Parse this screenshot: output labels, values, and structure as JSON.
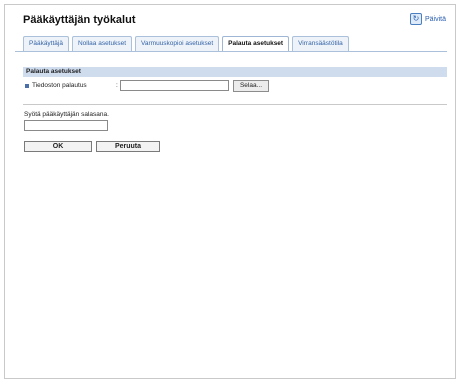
{
  "page": {
    "title": "Pääkäyttäjän työkalut"
  },
  "refresh": {
    "label": "Päivitä",
    "icon": "refresh-icon"
  },
  "tabs": [
    {
      "label": "Pääkäyttäjä",
      "active": false
    },
    {
      "label": "Nollaa asetukset",
      "active": false
    },
    {
      "label": "Varmuuskopioi asetukset",
      "active": false
    },
    {
      "label": "Palauta asetukset",
      "active": true
    },
    {
      "label": "Virransäästötila",
      "active": false
    }
  ],
  "section": {
    "title": "Palauta asetukset"
  },
  "restore": {
    "label": "Tiedoston palautus",
    "colon": ":",
    "file_value": "",
    "browse_label": "Selaa..."
  },
  "password": {
    "label": "Syötä pääkäyttäjän salasana.",
    "value": ""
  },
  "actions": {
    "ok_label": "OK",
    "cancel_label": "Peruuta"
  },
  "colors": {
    "tab_text": "#3564a8",
    "section_bar": "#cfdcee",
    "accent": "#4b6fa8"
  }
}
